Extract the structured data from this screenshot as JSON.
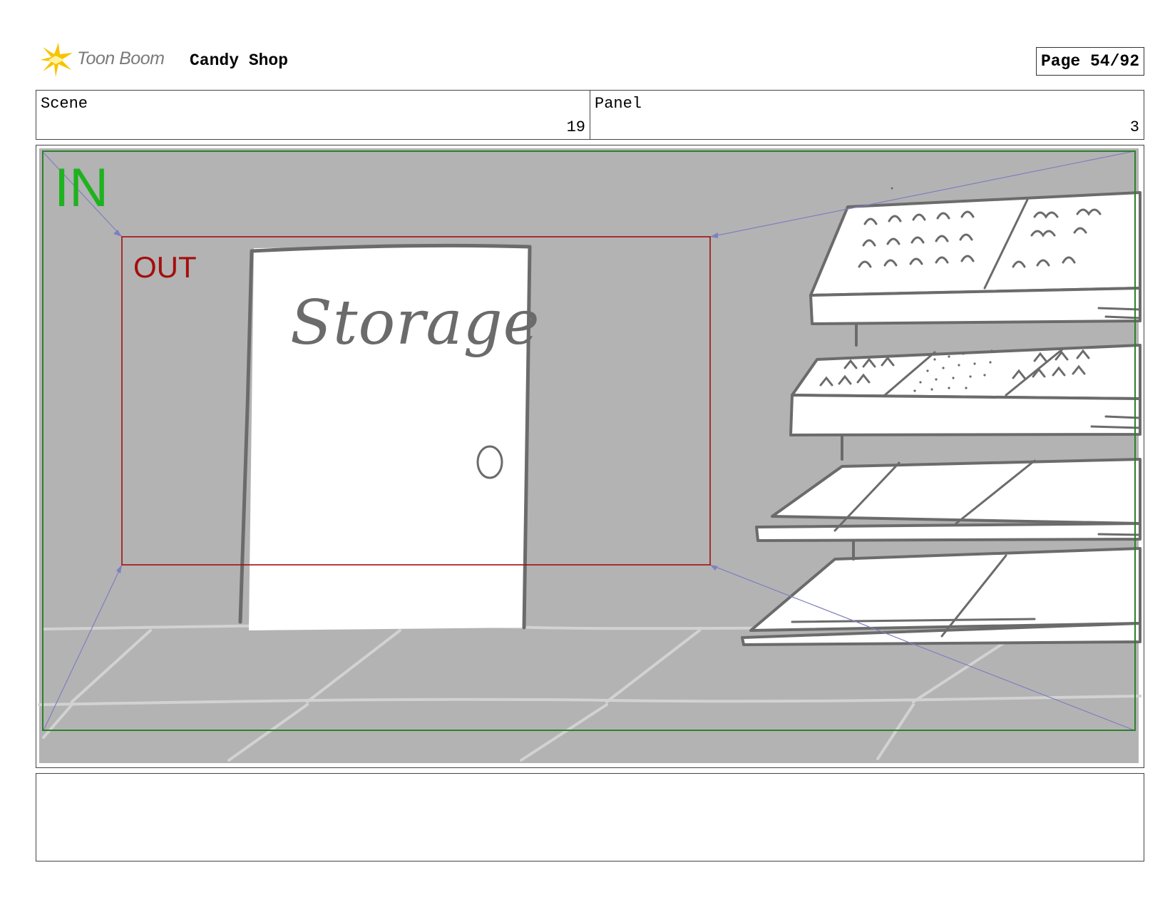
{
  "header": {
    "logo_text": "Toon Boom",
    "project_title": "Candy Shop",
    "page_indicator": "Page 54/92"
  },
  "info": {
    "scene_label": "Scene",
    "scene_value": "19",
    "panel_label": "Panel",
    "panel_value": "3"
  },
  "frame": {
    "in_label": "IN",
    "out_label": "OUT",
    "door_sign": "Storage"
  },
  "colors": {
    "in_frame": "#1fb21f",
    "out_frame": "#a50d0d",
    "camera_lines": "#7f7fc0",
    "background_fill": "#b3b3b3",
    "sketch_lines": "#6b6b6b"
  },
  "notes": {
    "text": ""
  }
}
